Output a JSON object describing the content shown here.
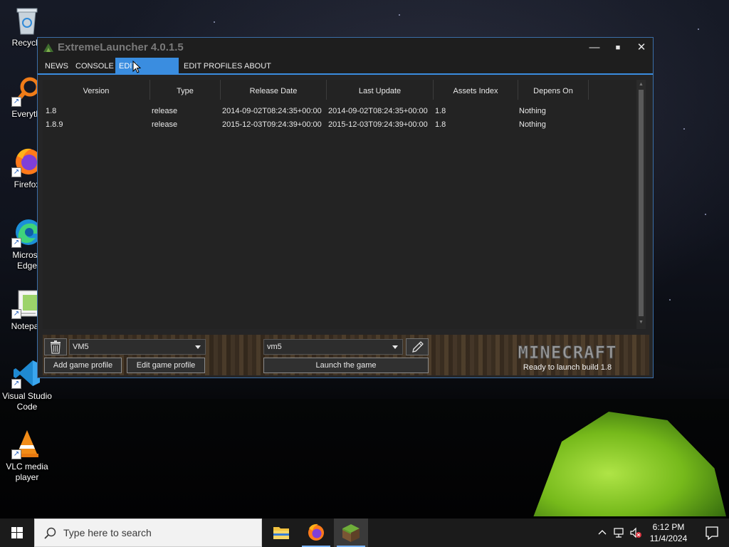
{
  "desktop": {
    "icons": [
      {
        "label": "Recycle",
        "icon": "recycle-bin-icon"
      },
      {
        "label": "Everythi",
        "icon": "everything-search-icon"
      },
      {
        "label": "Firefox",
        "icon": "firefox-icon"
      },
      {
        "label": "Microsoft Edge",
        "line1": "Microsc",
        "line2": "Edge",
        "icon": "edge-icon"
      },
      {
        "label": "Notepad",
        "line1": "Notepac",
        "icon": "notepad-icon"
      },
      {
        "label": "Visual Studio Code",
        "line1": "Visual Studio",
        "line2": "Code",
        "icon": "vscode-icon"
      },
      {
        "label": "VLC media player",
        "line1": "VLC media",
        "line2": "player",
        "icon": "vlc-icon"
      }
    ]
  },
  "window": {
    "title": "ExtremeLauncher 4.0.1.5",
    "controls": {
      "minimize": "—",
      "maximize": "■",
      "close": "✕"
    },
    "menu": [
      {
        "label": "NEWS",
        "active": false
      },
      {
        "label": "CONSOLE",
        "active": false
      },
      {
        "label": "EDIT VERSIONS",
        "active": true
      },
      {
        "label": "EDIT PROFILES",
        "active": false
      },
      {
        "label": "ABOUT",
        "active": false
      }
    ],
    "table": {
      "headers": [
        "Version",
        "Type",
        "Release Date",
        "Last Update",
        "Assets Index",
        "Depens On"
      ],
      "rows": [
        [
          "1.8",
          "release",
          "2014-09-02T08:24:35+00:00",
          "2014-09-02T08:24:35+00:00",
          "1.8",
          "Nothing"
        ],
        [
          "1.8.9",
          "release",
          "2015-12-03T09:24:39+00:00",
          "2015-12-03T09:24:39+00:00",
          "1.8",
          "Nothing"
        ]
      ]
    },
    "bottom": {
      "delete_icon": "trash-icon",
      "profile_select": "VM5",
      "add_profile_label": "Add game profile",
      "edit_profile_label": "Edit game profile",
      "version_select": "vm5",
      "edit_icon": "pencil-icon",
      "launch_label": "Launch the game",
      "logo_text": "MINECRAFT",
      "status": "Ready to launch build 1.8"
    }
  },
  "taskbar": {
    "search_placeholder": "Type here to search",
    "apps": [
      {
        "name": "file-explorer",
        "icon": "folder-icon",
        "active": false
      },
      {
        "name": "firefox",
        "icon": "firefox-icon",
        "active": false
      },
      {
        "name": "minecraft-launcher",
        "icon": "grass-block-icon",
        "active": true
      }
    ],
    "time": "6:12 PM",
    "date": "11/4/2024",
    "tray_icons": [
      "chevron-up-icon",
      "network-icon",
      "volume-muted-icon",
      "notification-icon"
    ]
  },
  "colors": {
    "accent": "#3a8de0",
    "window_bg": "#252526",
    "titlebar_bg": "#1e1e1e",
    "taskbar_bg": "#1b1b1b"
  }
}
